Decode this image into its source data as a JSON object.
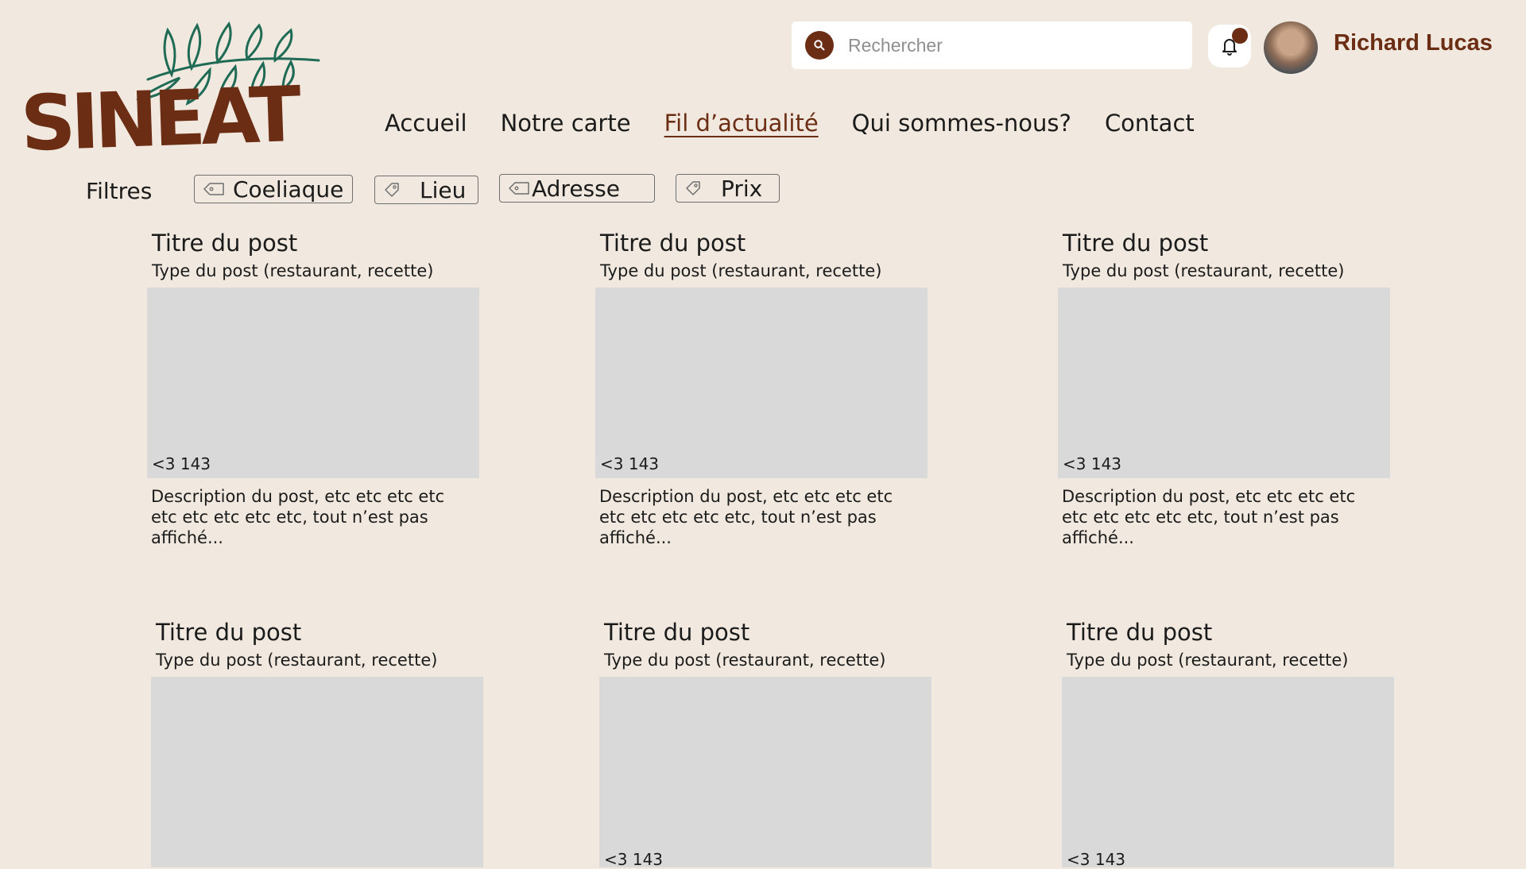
{
  "brand": {
    "name": "SINEAT",
    "color": "#6b2e14",
    "leaf_color": "#1f6b55"
  },
  "nav": {
    "items": [
      {
        "label": "Accueil"
      },
      {
        "label": "Notre carte"
      },
      {
        "label": "Fil d’actualité",
        "active": true
      },
      {
        "label": "Qui sommes-nous?"
      },
      {
        "label": "Contact"
      }
    ]
  },
  "search": {
    "placeholder": "Rechercher",
    "icon": "search-icon"
  },
  "notifications": {
    "icon": "bell-icon",
    "has_unread": true
  },
  "user": {
    "name": "Richard Lucas"
  },
  "filters": {
    "label": "Filtres",
    "chips": [
      {
        "label": "Coeliaque",
        "icon": "tag-icon"
      },
      {
        "label": "Lieu",
        "icon": "tag-icon"
      },
      {
        "label": "Adresse",
        "icon": "tag-icon"
      },
      {
        "label": "Prix",
        "icon": "tag-icon"
      }
    ]
  },
  "posts": [
    {
      "title": "Titre du post",
      "type": "Type du post (restaurant, recette)",
      "likes": "<3 143",
      "description": "Description du post, etc etc etc etc etc etc etc etc etc, tout n’est pas affiché..."
    },
    {
      "title": "Titre du post",
      "type": "Type du post (restaurant, recette)",
      "likes": "<3 143",
      "description": "Description du post, etc etc etc etc etc etc etc etc etc, tout n’est pas affiché..."
    },
    {
      "title": "Titre du post",
      "type": "Type du post (restaurant, recette)",
      "likes": "<3 143",
      "description": "Description du post, etc etc etc etc etc etc etc etc etc, tout n’est pas affiché..."
    },
    {
      "title": "Titre du post",
      "type": "Type du post (restaurant, recette)",
      "likes": ""
    },
    {
      "title": "Titre du post",
      "type": "Type du post (restaurant, recette)",
      "likes": "<3 143"
    },
    {
      "title": "Titre du post",
      "type": "Type du post (restaurant, recette)",
      "likes": "<3 143"
    }
  ]
}
